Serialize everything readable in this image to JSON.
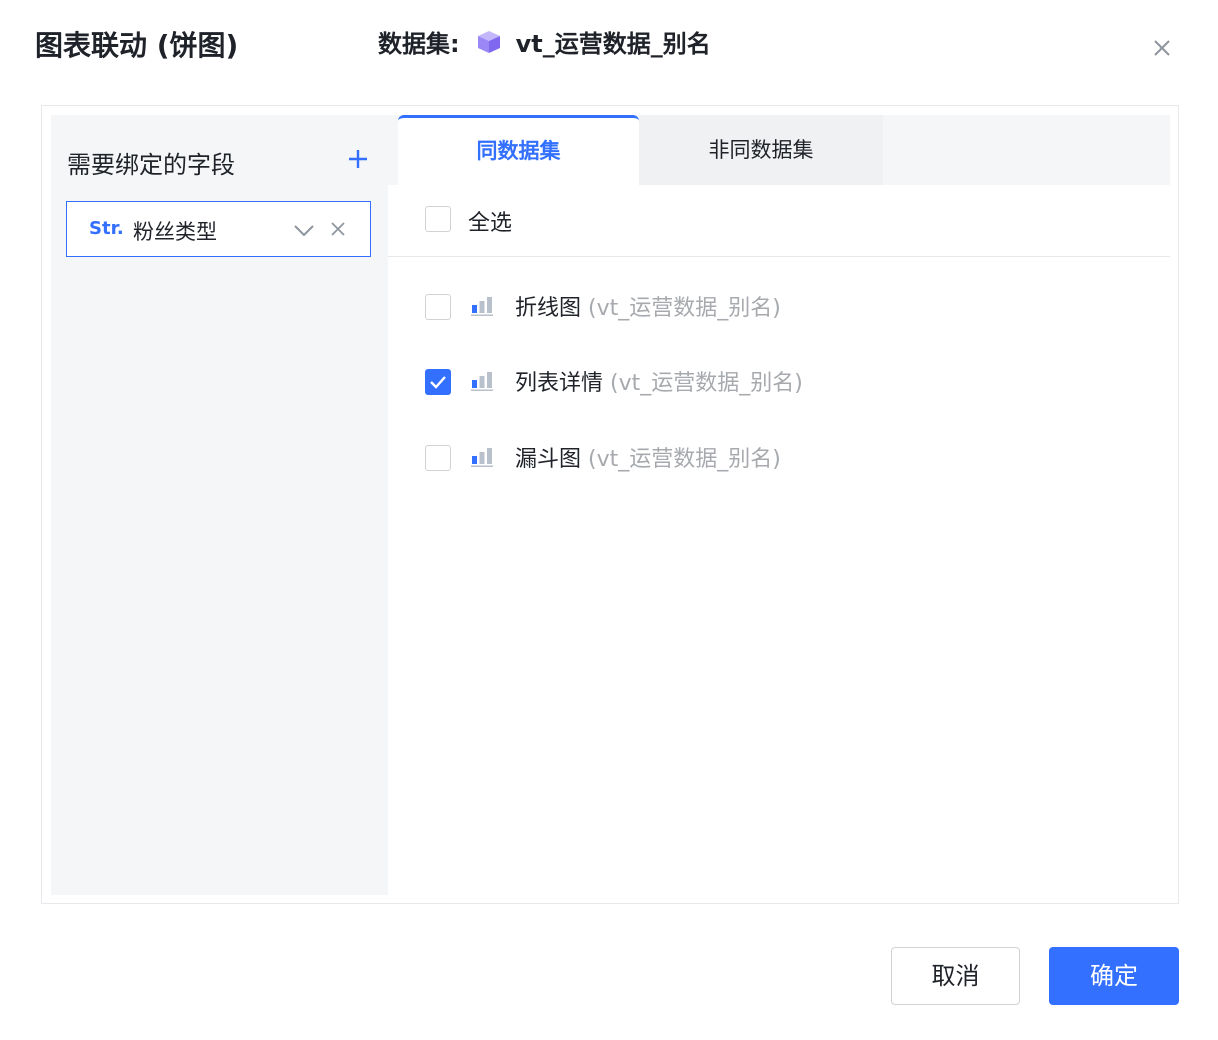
{
  "dialog": {
    "title": "图表联动 (饼图)",
    "dataset_prefix": "数据集:",
    "dataset_name": "vt_运营数据_别名"
  },
  "left": {
    "title": "需要绑定的字段",
    "field": {
      "type": "Str.",
      "name": "粉丝类型"
    }
  },
  "tabs": [
    {
      "label": "同数据集",
      "active": true
    },
    {
      "label": "非同数据集",
      "active": false
    }
  ],
  "select_all": {
    "label": "全选",
    "checked": false
  },
  "charts": [
    {
      "name": "折线图",
      "dataset": "(vt_运营数据_别名)",
      "checked": false
    },
    {
      "name": "列表详情",
      "dataset": "(vt_运营数据_别名)",
      "checked": true
    },
    {
      "name": "漏斗图",
      "dataset": "(vt_运营数据_别名)",
      "checked": false
    }
  ],
  "footer": {
    "cancel": "取消",
    "confirm": "确定"
  },
  "colors": {
    "accent": "#3370ff",
    "cube": "#9b87f5",
    "muted": "#a6a9ad"
  }
}
